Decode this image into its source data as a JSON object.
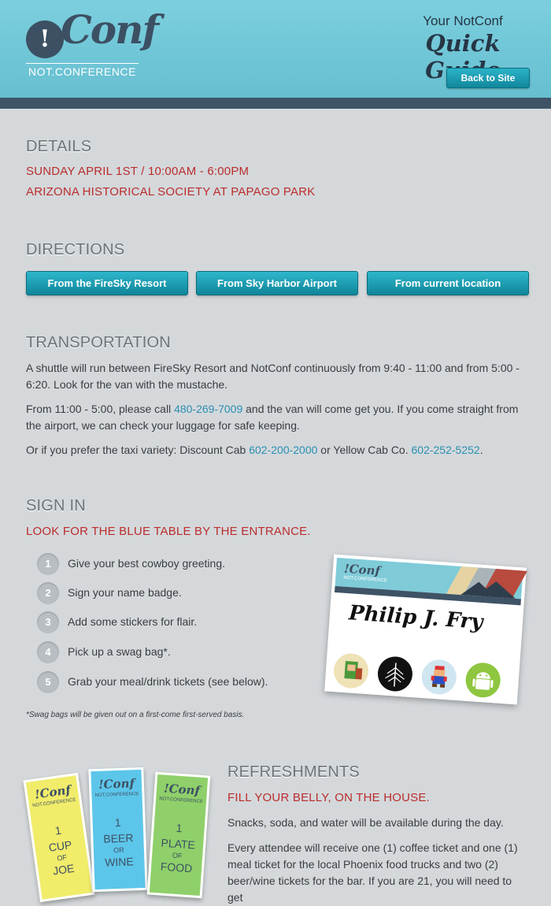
{
  "header": {
    "logo_mark": "!",
    "logo_word": "Conf",
    "logo_subtitle": "NOT.CONFERENCE",
    "guide_small": "Your NotConf",
    "guide_big": "Quick Guide",
    "back_button": "Back to Site"
  },
  "details": {
    "heading": "DETAILS",
    "date_time": "SUNDAY APRIL 1ST / 10:00AM - 6:00PM",
    "location": "ARIZONA HISTORICAL SOCIETY AT PAPAGO PARK"
  },
  "directions": {
    "heading": "DIRECTIONS",
    "buttons": [
      "From the FireSky Resort",
      "From Sky Harbor Airport",
      "From current location"
    ]
  },
  "transportation": {
    "heading": "TRANSPORTATION",
    "p1": "A shuttle will run between FireSky Resort and NotConf continuously from 9:40 - 11:00 and from 5:00 - 6:20. Look for the van with the mustache.",
    "p2_before": "From 11:00 - 5:00, please call ",
    "p2_phone": "480-269-7009",
    "p2_after": " and the van will come get you. If you come straight from the airport, we can check your luggage for safe keeping.",
    "p3_before": "Or if you prefer the taxi variety: Discount Cab ",
    "p3_phone1": "602-200-2000",
    "p3_mid": " or Yellow Cab Co. ",
    "p3_phone2": "602-252-5252",
    "p3_end": "."
  },
  "signin": {
    "heading": "SIGN IN",
    "subheading": "LOOK FOR THE BLUE TABLE BY THE ENTRANCE.",
    "steps": [
      {
        "num": "1",
        "text": "Give your best cowboy greeting."
      },
      {
        "num": "2",
        "text": "Sign your name badge."
      },
      {
        "num": "3",
        "text": "Add some stickers for flair."
      },
      {
        "num": "4",
        "text": "Pick up a swag bag*."
      },
      {
        "num": "5",
        "text": "Grab your meal/drink tickets (see below)."
      }
    ],
    "note": "*Swag bags will be given out on a first-come first-served basis.",
    "badge_logo": "!Conf",
    "badge_logo_sub": "NOT.CONFERENCE",
    "badge_name": "Philip J. Fry"
  },
  "refreshments": {
    "heading": "REFRESHMENTS",
    "subheading": "FILL YOUR BELLY, ON THE HOUSE.",
    "p1": "Snacks, soda, and water will be available during the day.",
    "p2": "Every attendee will receive one (1) coffee ticket and one (1) meal ticket for the local Phoenix food trucks and two (2) beer/wine tickets for the bar. If you are 21, you will need to get",
    "tickets": [
      {
        "logo": "!Conf",
        "sub": "NOT.CONFERENCE",
        "line1": "1",
        "line2": "CUP",
        "line3": "of",
        "line4": "JOE",
        "color": "#f1ec6a"
      },
      {
        "logo": "!Conf",
        "sub": "NOT.CONFERENCE",
        "line1": "1",
        "line2": "BEER",
        "line3": "or",
        "line4": "WINE",
        "color": "#5cc6ea"
      },
      {
        "logo": "!Conf",
        "sub": "NOT.CONFERENCE",
        "line1": "1",
        "line2": "PLATE",
        "line3": "of",
        "line4": "FOOD",
        "color": "#8fd06a"
      }
    ]
  }
}
